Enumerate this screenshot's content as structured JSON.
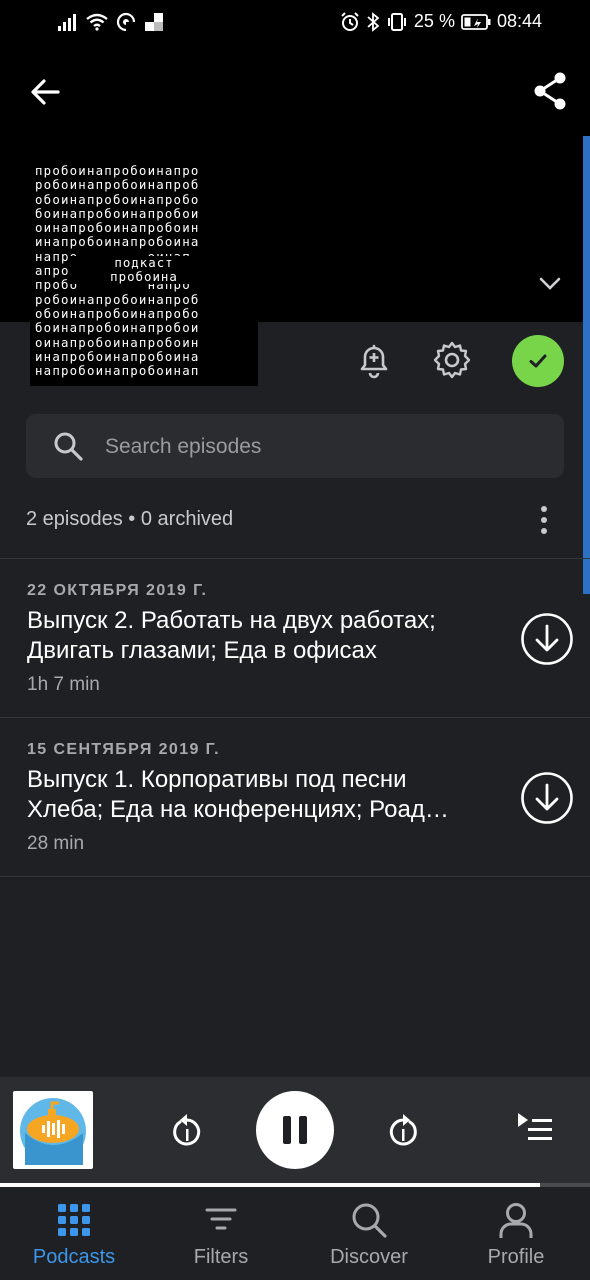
{
  "status_bar": {
    "battery": "25 %",
    "time": "08:44"
  },
  "artwork": {
    "pattern_lines": [
      "пробоинапробоинапро",
      "робоинапробоинапроб",
      "обоинапробоинапробо",
      "боинапробоинапробои",
      "оинапробоинапробоин",
      "инапробоинапробоина",
      "напро        оинап",
      "апроб        инапр",
      "пробо        напро",
      "робоинапробоинапроб",
      "обоинапробоинапробо",
      "боинапробоинапробои",
      "оинапробоинапробоин",
      "инапробоинапробоина",
      "напробоинапробоинап"
    ],
    "title_line1": "подкаст",
    "title_line2": "пробоина"
  },
  "search": {
    "placeholder": "Search episodes"
  },
  "episode_count": "2 episodes • 0 archived",
  "episodes": [
    {
      "date": "22 ОКТЯБРЯ 2019 Г.",
      "title_line1": "Выпуск 2. Работать на двух работах;",
      "title_line2": "Двигать глазами; Еда в офисах",
      "duration": "1h 7 min"
    },
    {
      "date": "15 СЕНТЯБРЯ 2019 Г.",
      "title_line1": "Выпуск 1. Корпоративы под песни",
      "title_line2": "Хлеба; Еда на конференциях; Роад…",
      "duration": "28 min"
    }
  ],
  "player": {
    "progress": 0.915
  },
  "nav": [
    {
      "label": "Podcasts",
      "icon": "grid-icon",
      "active": true
    },
    {
      "label": "Filters",
      "icon": "filter-icon",
      "active": false
    },
    {
      "label": "Discover",
      "icon": "search-icon",
      "active": false
    },
    {
      "label": "Profile",
      "icon": "person-icon",
      "active": false
    }
  ],
  "colors": {
    "accent": "#3d96ea",
    "subscribed": "#78d549",
    "background": "#1f2023",
    "header": "#000000"
  }
}
